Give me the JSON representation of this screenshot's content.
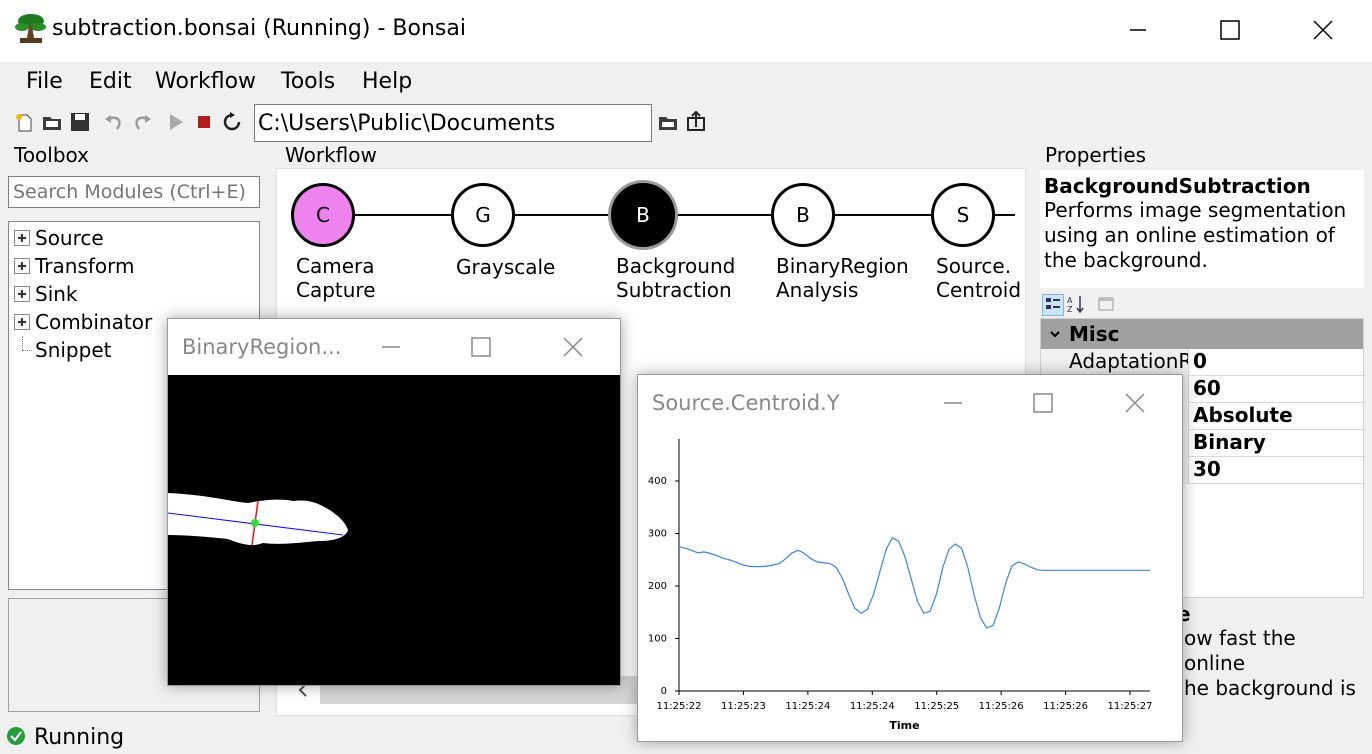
{
  "window": {
    "title": "subtraction.bonsai (Running) - Bonsai"
  },
  "menu": [
    "File",
    "Edit",
    "Workflow",
    "Tools",
    "Help"
  ],
  "toolbar": {
    "path": "C:\\Users\\Public\\Documents"
  },
  "toolbox": {
    "label": "Toolbox",
    "search_placeholder": "Search Modules (Ctrl+E)",
    "items": [
      "Source",
      "Transform",
      "Sink",
      "Combinator",
      "Snippet"
    ]
  },
  "workflow": {
    "label": "Workflow",
    "nodes": [
      {
        "letter": "C",
        "line1": "Camera",
        "line2": "Capture",
        "fill": "#ee82ee",
        "text_color": "#000000"
      },
      {
        "letter": "G",
        "line1": "Grayscale",
        "line2": "",
        "fill": "#ffffff",
        "text_color": "#000000"
      },
      {
        "letter": "B",
        "line1": "Background",
        "line2": "Subtraction",
        "fill": "#000000",
        "text_color": "#ffffff"
      },
      {
        "letter": "B",
        "line1": "BinaryRegion",
        "line2": "Analysis",
        "fill": "#ffffff",
        "text_color": "#000000"
      },
      {
        "letter": "S",
        "line1": "Source.",
        "line2": "Centroid",
        "fill": "#ffffff",
        "text_color": "#000000"
      }
    ]
  },
  "properties": {
    "label": "Properties",
    "selected_name": "BackgroundSubtraction",
    "selected_description": "Performs image segmentation using an online estimation of the background.",
    "category": "Misc",
    "rows": [
      {
        "name": "AdaptationR",
        "value": "0"
      },
      {
        "name": "",
        "value": "60"
      },
      {
        "name": "",
        "value": "Absolute"
      },
      {
        "name": "",
        "value": "Binary"
      },
      {
        "name": "",
        "value": "30"
      }
    ],
    "help_name": "ate",
    "help_line1": "ow fast the online",
    "help_line2": "he background is"
  },
  "status": {
    "text": "Running"
  },
  "region_window": {
    "title": "BinaryRegion..."
  },
  "plot_window": {
    "title": "Source.Centroid.Y"
  },
  "chart_data": {
    "type": "line",
    "title": "",
    "xlabel": "Time",
    "ylabel": "",
    "x_tick_labels": [
      "11:25:22",
      "11:25:23",
      "11:25:24",
      "11:25:24",
      "11:25:25",
      "11:25:26",
      "11:25:26",
      "11:25:27"
    ],
    "y_ticks": [
      0,
      100,
      200,
      300,
      400
    ],
    "ylim": [
      0,
      480
    ],
    "x": [
      0,
      0.2,
      0.4,
      0.6,
      0.8,
      1.0,
      1.2,
      1.4,
      1.6,
      1.8,
      2.0,
      2.2,
      2.4,
      2.6,
      2.8,
      3.0,
      3.2,
      3.4,
      3.6,
      3.8,
      4.0,
      4.2,
      4.4,
      4.6,
      4.8,
      5.0,
      5.2,
      5.4,
      5.6,
      5.8,
      6.0,
      6.2,
      6.4,
      6.6,
      6.8,
      7.0,
      7.2,
      7.4,
      7.6,
      7.8,
      8.0,
      8.2,
      8.4,
      8.6,
      8.8,
      9.0,
      9.2,
      9.4,
      9.6,
      9.8,
      10.0,
      10.2,
      10.4,
      10.6,
      10.8,
      11.0,
      11.2,
      11.4,
      11.6,
      11.8,
      12.0,
      12.2,
      12.4,
      12.6,
      12.8,
      13.0,
      13.2,
      13.4,
      13.6,
      13.8,
      14.0,
      14.2,
      14.4,
      14.6,
      14.8,
      15.0
    ],
    "series": [
      {
        "name": "",
        "color": "#3a87d6",
        "values": [
          275,
          272,
          268,
          263,
          265,
          262,
          258,
          253,
          250,
          246,
          241,
          238,
          237,
          237,
          238,
          240,
          243,
          252,
          263,
          268,
          262,
          252,
          246,
          244,
          243,
          236,
          215,
          185,
          158,
          148,
          155,
          185,
          228,
          270,
          292,
          285,
          255,
          212,
          170,
          148,
          152,
          185,
          235,
          270,
          280,
          272,
          235,
          182,
          140,
          120,
          125,
          158,
          205,
          238,
          246,
          242,
          236,
          231,
          230,
          230,
          230,
          230,
          230,
          230,
          230,
          230,
          230,
          230,
          230,
          230,
          230,
          230,
          230,
          230,
          230,
          230
        ]
      }
    ],
    "grid": false,
    "legend": "none"
  }
}
